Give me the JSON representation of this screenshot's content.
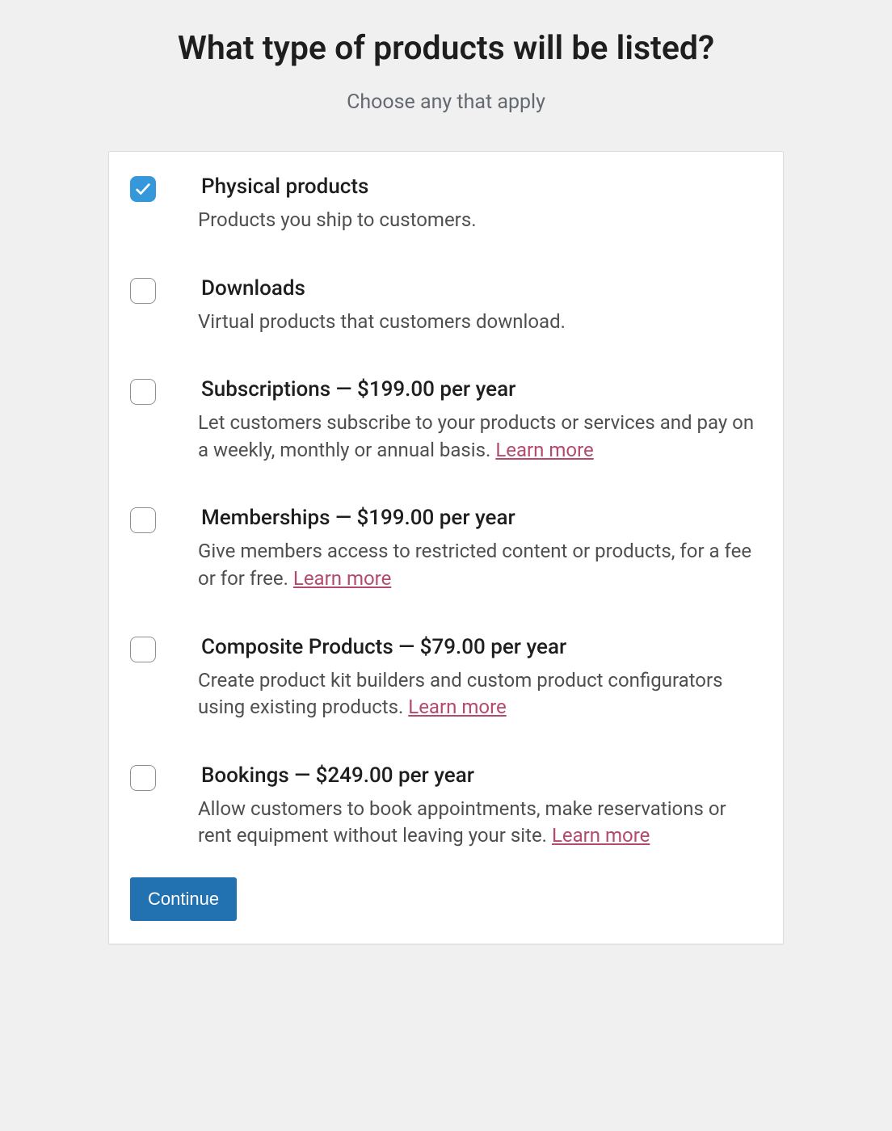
{
  "heading": "What type of products will be listed?",
  "subheading": "Choose any that apply",
  "options": [
    {
      "title": "Physical products",
      "desc": "Products you ship to customers.",
      "learn_more": null,
      "checked": true
    },
    {
      "title": "Downloads",
      "desc": "Virtual products that customers download.",
      "learn_more": null,
      "checked": false
    },
    {
      "title": "Subscriptions — $199.00 per year",
      "desc": "Let customers subscribe to your products or services and pay on a weekly, monthly or annual basis. ",
      "learn_more": "Learn more",
      "checked": false
    },
    {
      "title": "Memberships — $199.00 per year",
      "desc": "Give members access to restricted content or products, for a fee or for free. ",
      "learn_more": "Learn more",
      "checked": false
    },
    {
      "title": "Composite Products — $79.00 per year",
      "desc": "Create product kit builders and custom product configurators using existing products. ",
      "learn_more": "Learn more",
      "checked": false
    },
    {
      "title": "Bookings — $249.00 per year",
      "desc": "Allow customers to book appointments, make reservations or rent equipment without leaving your site. ",
      "learn_more": "Learn more",
      "checked": false
    }
  ],
  "continue_label": "Continue"
}
